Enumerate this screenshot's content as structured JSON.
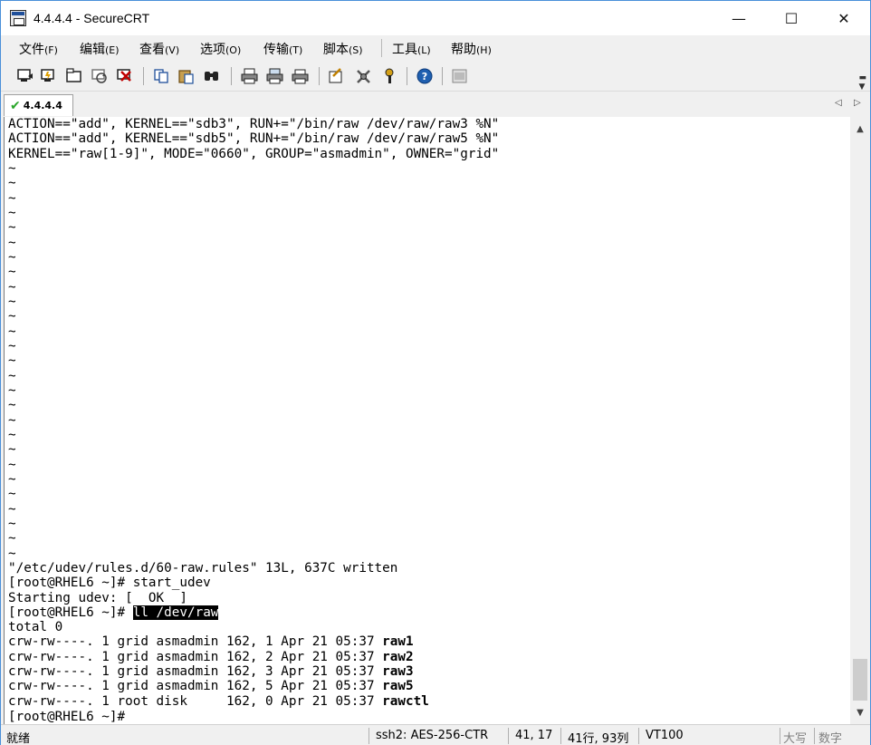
{
  "window": {
    "title": "4.4.4.4 - SecureCRT",
    "controls": {
      "minimize": "—",
      "maximize": "☐",
      "close": "✕"
    }
  },
  "menu": [
    {
      "label": "文件",
      "accel": "(F)"
    },
    {
      "label": "编辑",
      "accel": "(E)"
    },
    {
      "label": "查看",
      "accel": "(V)"
    },
    {
      "label": "选项",
      "accel": "(O)"
    },
    {
      "label": "传输",
      "accel": "(T)"
    },
    {
      "label": "脚本",
      "accel": "(S)"
    },
    {
      "label": "工具",
      "accel": "(L)"
    },
    {
      "label": "帮助",
      "accel": "(H)"
    }
  ],
  "toolbar": {
    "icons": [
      "connect-icon",
      "quick-connect-icon",
      "connect-tab-icon",
      "reconnect-icon",
      "disconnect-icon",
      "copy-icon",
      "paste-icon",
      "find-icon",
      "print-icon",
      "print-selection-icon",
      "print-setup-icon",
      "session-options-icon",
      "global-options-icon",
      "keymap-icon",
      "help-icon",
      "about-icon"
    ]
  },
  "tabs": [
    {
      "label": "4.4.4.4",
      "status": "connected"
    }
  ],
  "terminal": {
    "lines": [
      "ACTION==\"add\", KERNEL==\"sdb3\", RUN+=\"/bin/raw /dev/raw/raw3 %N\"",
      "ACTION==\"add\", KERNEL==\"sdb5\", RUN+=\"/bin/raw /dev/raw/raw5 %N\"",
      "KERNEL==\"raw[1-9]\", MODE=\"0660\", GROUP=\"asmadmin\", OWNER=\"grid\"",
      "~",
      "~",
      "~",
      "~",
      "~",
      "~",
      "~",
      "~",
      "~",
      "~",
      "~",
      "~",
      "~",
      "~",
      "~",
      "~",
      "~",
      "~",
      "~",
      "~",
      "~",
      "~",
      "~",
      "~",
      "~",
      "~",
      "~",
      "\"/etc/udev/rules.d/60-raw.rules\" 13L, 637C written",
      "[root@RHEL6 ~]# start_udev",
      "Starting udev: [  OK  ]"
    ],
    "prompt": "[root@RHEL6 ~]# ",
    "highlighted_command": "ll /dev/raw",
    "total_line": "total 0",
    "listing": [
      {
        "perms": "crw-rw----. 1 grid asmadmin 162, 1 Apr 21 05:37 ",
        "name": "raw1"
      },
      {
        "perms": "crw-rw----. 1 grid asmadmin 162, 2 Apr 21 05:37 ",
        "name": "raw2"
      },
      {
        "perms": "crw-rw----. 1 grid asmadmin 162, 3 Apr 21 05:37 ",
        "name": "raw3"
      },
      {
        "perms": "crw-rw----. 1 grid asmadmin 162, 5 Apr 21 05:37 ",
        "name": "raw5"
      },
      {
        "perms": "crw-rw----. 1 root disk     162, 0 Apr 21 05:37 ",
        "name": "rawctl"
      }
    ],
    "last_prompt": "[root@RHEL6 ~]#"
  },
  "status_bar": {
    "ready": "就绪",
    "cipher": "ssh2: AES-256-CTR",
    "cursor_pos": "41, 17",
    "size": "41行, 93列",
    "emulation": "VT100",
    "caps": "大写",
    "num": "数字"
  }
}
